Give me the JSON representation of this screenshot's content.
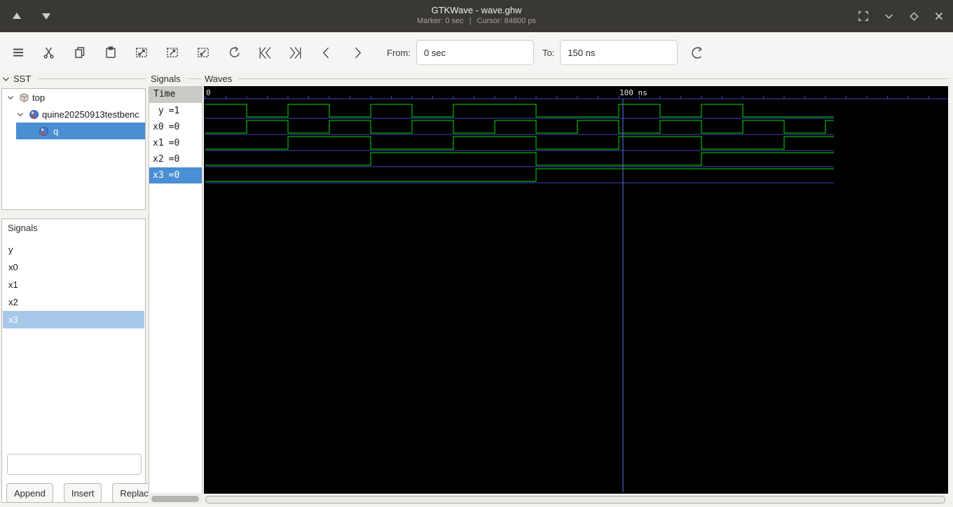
{
  "titlebar": {
    "title": "GTKWave - wave.ghw",
    "marker_text": "Marker: 0 sec",
    "separator": "|",
    "cursor_text": "Cursor: 84800 ps"
  },
  "toolbar": {
    "from_label": "From:",
    "from_value": "0 sec",
    "to_label": "To:",
    "to_value": "150 ns",
    "icons": [
      "menu",
      "cut",
      "copy",
      "paste",
      "zoom-fit",
      "zoom-in",
      "zoom-out",
      "zoom-undo",
      "to-start",
      "to-end",
      "prev-edge",
      "next-edge",
      "reload"
    ]
  },
  "sst": {
    "label": "SST",
    "tree": [
      {
        "label": "top"
      },
      {
        "label": "quine20250913testbenc"
      },
      {
        "label": "q"
      }
    ]
  },
  "signal_list": {
    "label": "Signals",
    "items": [
      "y",
      "x0",
      "x1",
      "x2",
      "x3"
    ],
    "selected": "x3",
    "search_placeholder": "",
    "append_label": "Append",
    "insert_label": "Insert",
    "replace_label": "Replace"
  },
  "names_panel": {
    "label": "Signals",
    "time_header": "Time"
  },
  "waves": {
    "label": "Waves",
    "chart_data": {
      "type": "digital-waveform",
      "time_unit": "ns",
      "t_start": 0,
      "t_end": 152,
      "unit_ns": 10,
      "cursor_ns": 101,
      "tick_step_ns": 5,
      "tick_labels": [
        {
          "t": 0,
          "label": "0"
        },
        {
          "t": 100,
          "label": "100 ns"
        }
      ],
      "signals": [
        {
          "name": "y",
          "value": "=1",
          "bits": "1010101100101000"
        },
        {
          "name": "x0",
          "value": "=0",
          "bits": "0101010101010101"
        },
        {
          "name": "x1",
          "value": "=0",
          "bits": "0011001100110011"
        },
        {
          "name": "x2",
          "value": "=0",
          "bits": "0000111100001111"
        },
        {
          "name": "x3",
          "value": "=0",
          "bits": "0000000011111111"
        }
      ],
      "colors": {
        "background": "#000000",
        "wave": "#00dd00",
        "grid": "#4242c2",
        "cursor": "#5f6fe8",
        "tick_text": "#e6e6e4"
      }
    }
  }
}
